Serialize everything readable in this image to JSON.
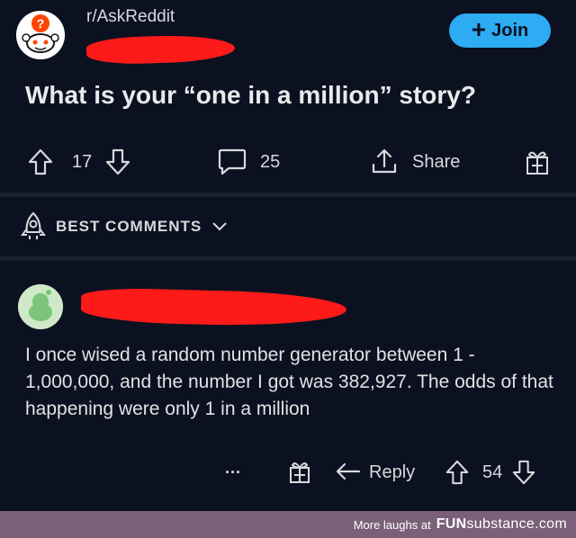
{
  "post": {
    "subreddit": "r/AskReddit",
    "join_label": "Join",
    "title": "What is your “one in a million” story?",
    "upvotes": "17",
    "comments": "25",
    "share_label": "Share"
  },
  "sort": {
    "label": "BEST COMMENTS"
  },
  "comment": {
    "text": "I once wised a random number generator between 1 - 1,000,000, and the number I got was 382,927. The odds of that happening were only 1 in a million",
    "more_label": "···",
    "reply_label": "Reply",
    "upvotes": "54"
  },
  "footer": {
    "text": "More laughs at",
    "brand_fun": "FUN",
    "brand_sub": "substance",
    "brand_tld": ".com"
  },
  "colors": {
    "background": "#0b1120",
    "join_button": "#2dabf3",
    "redaction": "#ff1a1a",
    "footer_bar": "#7a6078"
  },
  "icons": [
    "subreddit-avatar",
    "upvote-icon",
    "downvote-icon",
    "comment-icon",
    "share-icon",
    "award-icon",
    "rocket-icon",
    "chevron-down-icon",
    "reply-icon"
  ]
}
